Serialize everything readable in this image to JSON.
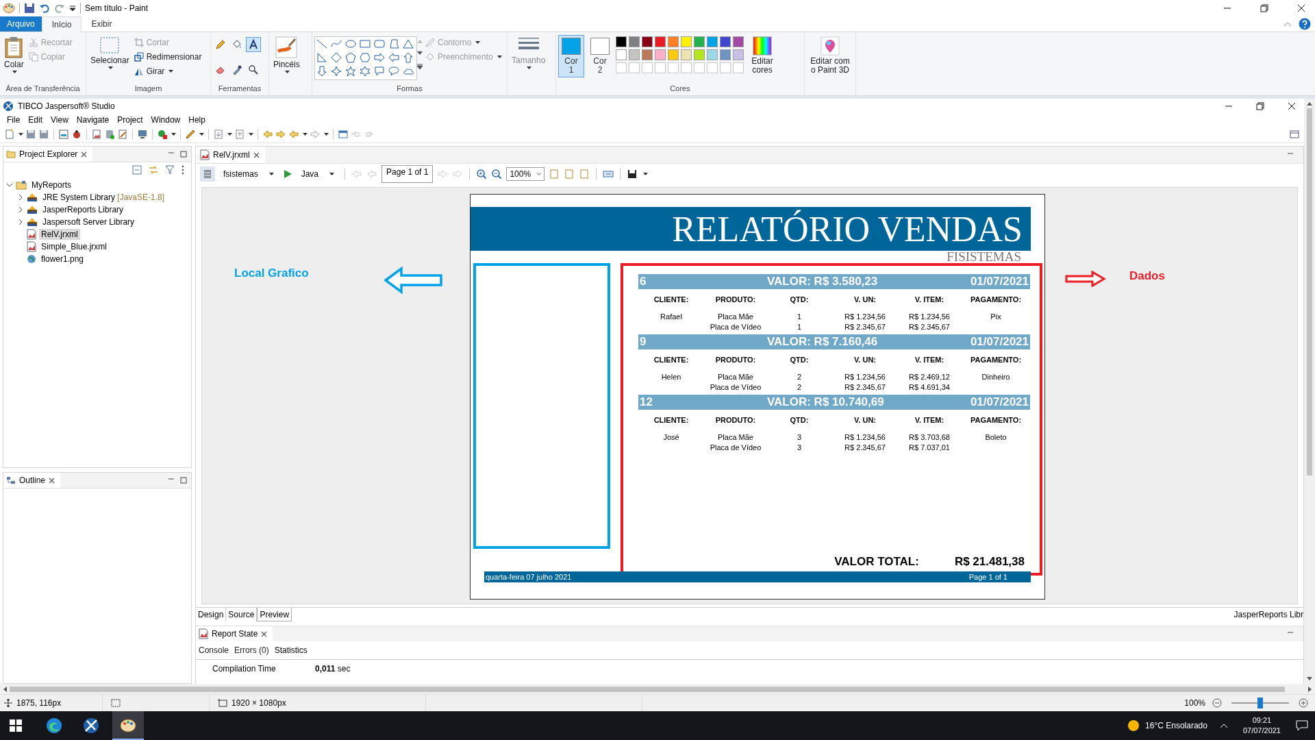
{
  "paint": {
    "title": "Sem título - Paint",
    "tabs": [
      {
        "label": "Arquivo",
        "kind": "file",
        "selected": false
      },
      {
        "label": "Início",
        "kind": "tab",
        "selected": true
      },
      {
        "label": "Exibir",
        "kind": "tab",
        "selected": false
      }
    ],
    "clipboard": {
      "label": "Área de Transferência",
      "paste": "Colar",
      "actions": [
        {
          "label": "Recortar",
          "kind": "cut",
          "disabled": true
        },
        {
          "label": "Copiar",
          "kind": "copy",
          "disabled": true
        }
      ]
    },
    "image": {
      "label": "Imagem",
      "select": "Selecionar",
      "actions": [
        {
          "label": "Cortar",
          "kind": "crop",
          "disabled": true
        },
        {
          "label": "Redimensionar",
          "kind": "resize",
          "disabled": false
        },
        {
          "label": "Girar",
          "kind": "rotate",
          "disabled": false
        }
      ]
    },
    "tools": {
      "label": "Ferramentas",
      "items": [
        {
          "kind": "pencil",
          "selected": false
        },
        {
          "kind": "fill",
          "selected": false
        },
        {
          "kind": "text",
          "selected": true
        },
        {
          "kind": "eraser",
          "selected": false
        },
        {
          "kind": "picker",
          "selected": false
        },
        {
          "kind": "magnifier",
          "selected": false
        }
      ]
    },
    "brushes": {
      "label": "Pincéis"
    },
    "shapes": {
      "label": "Formas",
      "outline": {
        "label": "Contorno",
        "disabled": true
      },
      "fill": {
        "label": "Preenchimento",
        "disabled": true
      }
    },
    "size": {
      "label": "Tamanho",
      "disabled": true
    },
    "colors": {
      "label": "Cores",
      "wells": [
        {
          "label": "Cor 1",
          "color": "#00a2e8",
          "selected": true
        },
        {
          "label": "Cor 2",
          "color": "#ffffff",
          "selected": false
        }
      ],
      "palette": [
        {
          "color": "#000000"
        },
        {
          "color": "#7f7f7f"
        },
        {
          "color": "#880015"
        },
        {
          "color": "#ed1c24"
        },
        {
          "color": "#ff7f27"
        },
        {
          "color": "#fff200"
        },
        {
          "color": "#22b14c"
        },
        {
          "color": "#00a2e8"
        },
        {
          "color": "#3f48cc"
        },
        {
          "color": "#a349a4"
        },
        {
          "color": "#ffffff"
        },
        {
          "color": "#c3c3c3"
        },
        {
          "color": "#b97a57"
        },
        {
          "color": "#ffaec9"
        },
        {
          "color": "#ffc90e"
        },
        {
          "color": "#efe4b0"
        },
        {
          "color": "#b5e61d"
        },
        {
          "color": "#99d9ea"
        },
        {
          "color": "#7092be"
        },
        {
          "color": "#c8bfe7"
        }
      ],
      "edit": "Editar cores"
    },
    "paint3d": "Editar com o Paint 3D",
    "status": {
      "position": "1875, 116px",
      "dimensions": "1920 × 1080px",
      "zoom": "100%",
      "zoom_slider": {
        "level": 0.5
      }
    }
  },
  "jasper": {
    "title": "TIBCO Jaspersoft® Studio",
    "menu": [
      "File",
      "Edit",
      "View",
      "Navigate",
      "Project",
      "Window",
      "Help"
    ],
    "explorer": {
      "title": "Project Explorer",
      "tree": [
        {
          "label": "MyReports",
          "kind": "project",
          "expanded": true,
          "selected": false,
          "children": [
            {
              "label": "JRE System Library",
              "decoration": "[JavaSE-1.8]",
              "kind": "library",
              "expanded": false,
              "selected": false
            },
            {
              "label": "JasperReports Library",
              "kind": "library",
              "expanded": false,
              "selected": false
            },
            {
              "label": "Jaspersoft Server Library",
              "kind": "library",
              "expanded": false,
              "selected": false
            },
            {
              "label": "RelV.jrxml",
              "kind": "report",
              "selected": true
            },
            {
              "label": "Simple_Blue.jrxml",
              "kind": "report",
              "selected": false
            },
            {
              "label": "flower1.png",
              "kind": "image",
              "selected": false
            }
          ]
        }
      ]
    },
    "outline": {
      "title": "Outline"
    },
    "editor": {
      "tab": "RelV.jrxml",
      "adapter": "fsistemas",
      "language": "Java",
      "page": "Page 1 of 1",
      "zoom": "100%",
      "report": {
        "title": "RELATÓRIO VENDAS",
        "subtitle": "FISISTEMAS",
        "annotations": [
          {
            "label": "Local Grafico",
            "color": "#00a2e8",
            "kind": "left"
          },
          {
            "label": "Dados",
            "color": "#ed1c24",
            "kind": "right"
          }
        ],
        "orders": [
          {
            "number": "6",
            "value": "VALOR: R$ 3.580,23",
            "date": "01/07/2021",
            "headers": [
              "CLIENTE:",
              "PRODUTO:",
              "QTD:",
              "V. UN:",
              "V. ITEM:",
              "PAGAMENTO:"
            ],
            "client": "Rafael",
            "payment": "Pix",
            "items": [
              {
                "product": "Placa Mãe",
                "qty": "1",
                "unit": "R$ 1.234,56",
                "total": "R$ 1.234,56"
              },
              {
                "product": "Placa de Vídeo",
                "qty": "1",
                "unit": "R$ 2.345,67",
                "total": "R$ 2.345,67"
              }
            ]
          },
          {
            "number": "9",
            "value": "VALOR: R$ 7.160,46",
            "date": "01/07/2021",
            "headers": [
              "CLIENTE:",
              "PRODUTO:",
              "QTD:",
              "V. UN:",
              "V. ITEM:",
              "PAGAMENTO:"
            ],
            "client": "Helen",
            "payment": "Dinheiro",
            "items": [
              {
                "product": "Placa Mãe",
                "qty": "2",
                "unit": "R$ 1.234,56",
                "total": "R$ 2.469,12"
              },
              {
                "product": "Placa de Vídeo",
                "qty": "2",
                "unit": "R$ 2.345,67",
                "total": "R$ 4.691,34"
              }
            ]
          },
          {
            "number": "12",
            "value": "VALOR: R$ 10.740,69",
            "date": "01/07/2021",
            "headers": [
              "CLIENTE:",
              "PRODUTO:",
              "QTD:",
              "V. UN:",
              "V. ITEM:",
              "PAGAMENTO:"
            ],
            "client": "José",
            "payment": "Boleto",
            "items": [
              {
                "product": "Placa Mãe",
                "qty": "3",
                "unit": "R$ 1.234,56",
                "total": "R$ 3.703,68"
              },
              {
                "product": "Placa de Vídeo",
                "qty": "3",
                "unit": "R$ 2.345,67",
                "total": "R$ 7.037,01"
              }
            ]
          }
        ],
        "total_label": "VALOR TOTAL:",
        "total": "R$ 21.481,38",
        "footer_date": "quarta-feira 07 julho 2021",
        "footer_page": "Page 1 of 1"
      },
      "bottom_tabs": [
        {
          "label": "Design",
          "selected": false
        },
        {
          "label": "Source",
          "selected": false
        },
        {
          "label": "Preview",
          "selected": true
        }
      ],
      "library_tab": "JasperReports Libr"
    },
    "report_state": {
      "title": "Report State",
      "tabs": [
        {
          "label": "Console",
          "selected": false
        },
        {
          "label": "Errors (0)",
          "selected": false
        },
        {
          "label": "Statistics",
          "selected": true
        }
      ],
      "rows": [
        {
          "label": "Compilation Time",
          "value": "**0,011** sec"
        }
      ]
    }
  },
  "taskbar": {
    "apps": [
      {
        "kind": "edge",
        "selected": false
      },
      {
        "kind": "jaspersoft",
        "selected": false
      },
      {
        "kind": "paint",
        "selected": true
      }
    ],
    "weather": "16°C Ensolarado",
    "time": "09:21",
    "date": "07/07/2021"
  }
}
